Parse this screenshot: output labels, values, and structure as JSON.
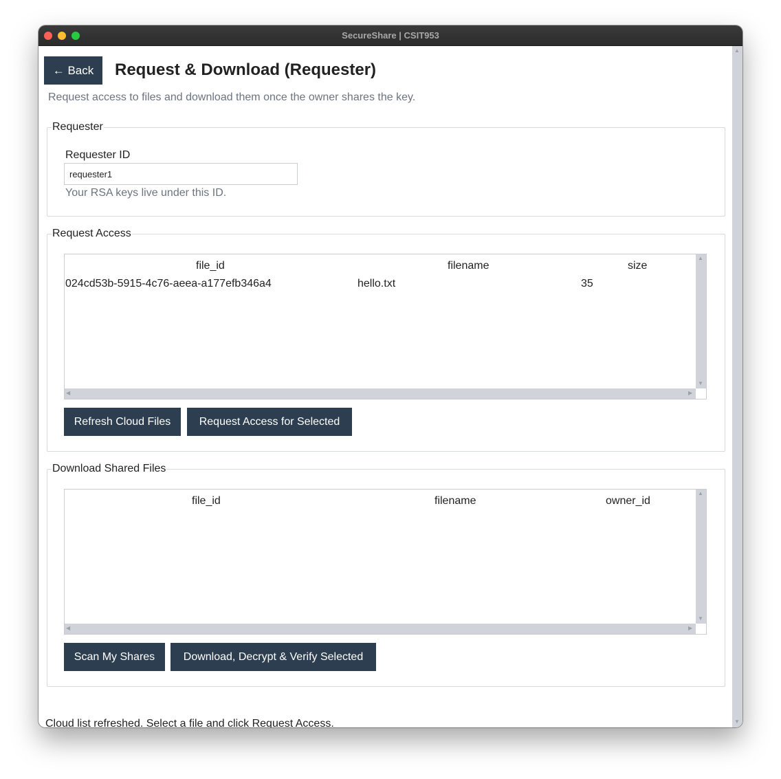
{
  "window": {
    "title": "SecureShare | CSIT953"
  },
  "header": {
    "back_label": "← Back",
    "title": "Request & Download (Requester)"
  },
  "subtitle": "Request access to files and download them once the owner shares the key.",
  "requester": {
    "legend": "Requester",
    "id_label": "Requester ID",
    "id_value": "requester1",
    "hint": "Your RSA keys live under this ID."
  },
  "request_access": {
    "legend": "Request Access",
    "columns": [
      "file_id",
      "filename",
      "size"
    ],
    "rows": [
      {
        "file_id": "024cd53b-5915-4c76-aeea-a177efb346a4",
        "filename": "hello.txt",
        "size": "35"
      }
    ],
    "refresh_label": "Refresh Cloud Files",
    "request_label": "Request Access for Selected"
  },
  "download": {
    "legend": "Download Shared Files",
    "columns": [
      "file_id",
      "filename",
      "owner_id"
    ],
    "rows": [],
    "scan_label": "Scan My Shares",
    "download_label": "Download, Decrypt & Verify Selected"
  },
  "status_text": "Cloud list refreshed. Select a file and click Request Access.",
  "colors": {
    "button_bg": "#2c3e50",
    "scrollbar": "#d0d4da",
    "muted_text": "#6b7480"
  },
  "icons": {
    "back": "left-arrow-icon",
    "scroll_up": "triangle-up-icon",
    "scroll_down": "triangle-down-icon",
    "scroll_left": "triangle-left-icon",
    "scroll_right": "triangle-right-icon"
  }
}
